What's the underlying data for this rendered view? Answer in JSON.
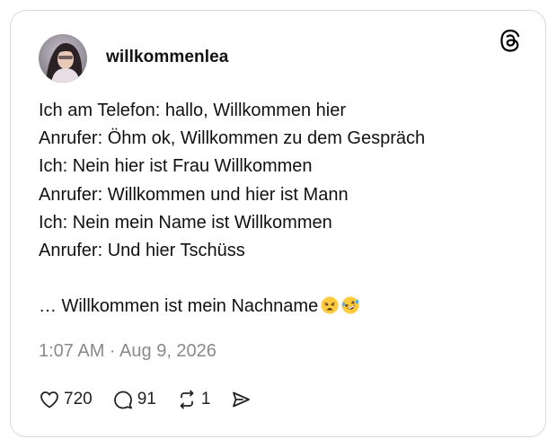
{
  "post": {
    "username": "willkommenlea",
    "lines": [
      "Ich am Telefon: hallo, Willkommen hier",
      "Anrufer: Öhm ok, Willkommen zu dem Gespräch",
      "Ich: Nein hier ist Frau Willkommen",
      "Anrufer: Willkommen und hier ist Mann",
      "Ich: Nein mein Name ist Willkommen",
      "Anrufer: Und hier Tschüss"
    ],
    "closing": "… Willkommen ist mein Nachname",
    "emojis": [
      "weary-face-emoji",
      "rolling-on-floor-laughing-emoji"
    ],
    "timestamp": "1:07 AM · Aug 9, 2026"
  },
  "stats": {
    "likes": "720",
    "replies": "91",
    "reposts": "1"
  },
  "icons": {
    "logo": "threads-logo-icon",
    "like": "heart-icon",
    "reply": "speech-bubble-icon",
    "repost": "repost-icon",
    "share": "send-icon"
  },
  "colors": {
    "text": "#111111",
    "muted": "#8a8a8a",
    "border": "#d9d9d9",
    "emoji_yellow": "#ffcb3d"
  }
}
